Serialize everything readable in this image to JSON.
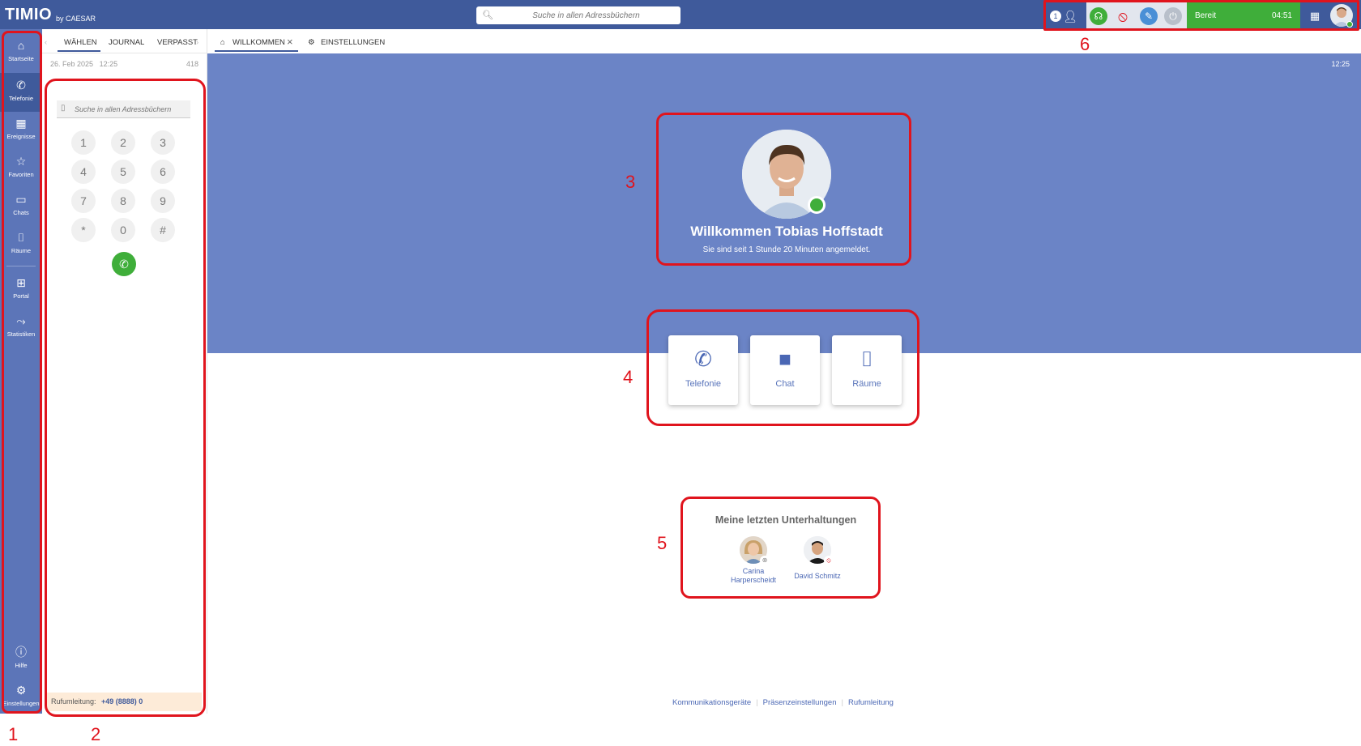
{
  "app": {
    "logo": "TIMIO",
    "logo_sub": "by CAESAR"
  },
  "top": {
    "search_placeholder": "Suche in allen Adressbüchern",
    "status_label": "Bereit",
    "status_time": "04:51",
    "presence_count": "1"
  },
  "sidebar": {
    "items": [
      {
        "label": "Startseite",
        "icon": "home-icon"
      },
      {
        "label": "Telefonie",
        "icon": "phone-forward-icon"
      },
      {
        "label": "Ereignisse",
        "icon": "calendar-icon"
      },
      {
        "label": "Favoriten",
        "icon": "star-icon"
      },
      {
        "label": "Chats",
        "icon": "chat-icon"
      },
      {
        "label": "Räume",
        "icon": "rooms-icon"
      },
      {
        "label": "Portal",
        "icon": "grid-icon"
      },
      {
        "label": "Statistiken",
        "icon": "stats-icon"
      }
    ],
    "bottom": [
      {
        "label": "Hilfe",
        "icon": "help-icon"
      },
      {
        "label": "Einstellungen",
        "icon": "gear-icon"
      }
    ]
  },
  "phone_panel": {
    "tabs": [
      "WÄHLEN",
      "JOURNAL",
      "VERPASST"
    ],
    "date": "26. Feb 2025",
    "time": "12:25",
    "count": "418",
    "search_placeholder": "Suche in allen Adressbüchern",
    "keys": [
      "1",
      "2",
      "3",
      "4",
      "5",
      "6",
      "7",
      "8",
      "9",
      "*",
      "0",
      "#"
    ],
    "forward_label": "Rufumleitung:",
    "forward_number": "+49 (8888) 0"
  },
  "main": {
    "tabs": [
      {
        "label": "WILLKOMMEN"
      },
      {
        "label": "EINSTELLUNGEN"
      }
    ],
    "banner_time": "12:25",
    "welcome_title": "Willkommen Tobias Hoffstadt",
    "welcome_sub": "Sie sind seit 1 Stunde 20 Minuten angemeldet.",
    "quick_actions": [
      {
        "label": "Telefonie",
        "icon": "phone-icon"
      },
      {
        "label": "Chat",
        "icon": "chat-icon"
      },
      {
        "label": "Räume",
        "icon": "rooms-icon"
      }
    ],
    "recent_title": "Meine letzten Unterhaltungen",
    "recent": [
      {
        "name_line1": "Carina",
        "name_line2": "Harperscheidt"
      },
      {
        "name_line1": "David Schmitz",
        "name_line2": ""
      }
    ],
    "footer_links": [
      "Kommunikationsgeräte",
      "Präsenzeinstellungen",
      "Rufumleitung"
    ]
  },
  "annotations": [
    "1",
    "2",
    "3",
    "4",
    "5",
    "6"
  ],
  "colors": {
    "topbar": "#3f5a9b",
    "sidebar": "#5c75b8",
    "banner": "#6b84c6",
    "accent_green": "#3fae3a",
    "annotation_red": "#e0141d"
  }
}
